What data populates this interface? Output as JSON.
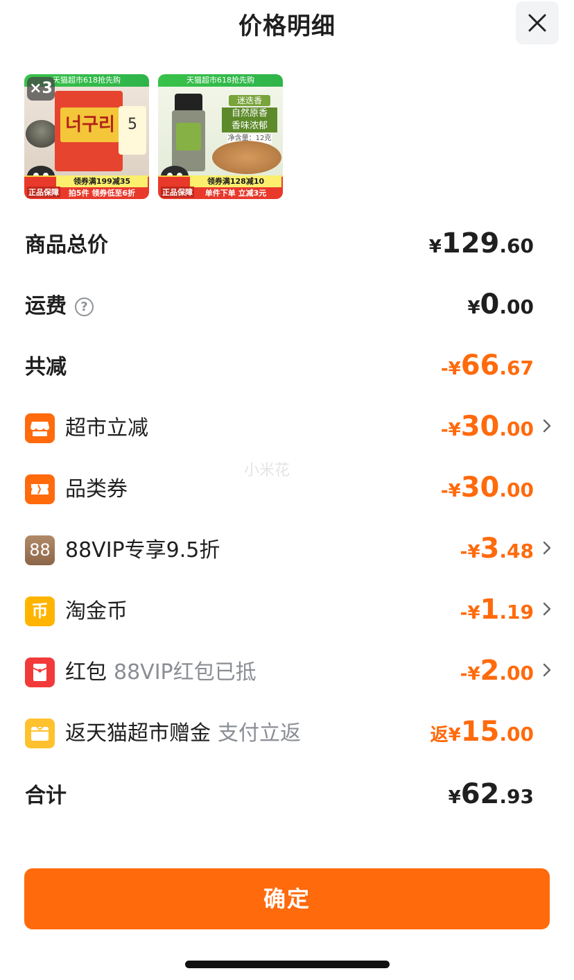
{
  "header": {
    "title": "价格明细"
  },
  "products": [
    {
      "qty_badge": "×3",
      "banner": "天猫超市618抢先购",
      "coupon_line": "领券满199减35",
      "promo_line": "拍5件 领券低至6折",
      "guarantee": "正品保障",
      "pack_text": "너구리",
      "pack_count": "5"
    },
    {
      "banner": "天猫超市618抢先购",
      "tag": "迷迭香",
      "line1": "自然原香",
      "line2": "香味浓郁",
      "net_weight": "净含量：12克",
      "coupon_line": "领券满128减10",
      "promo_line": "单件下单 立减3元",
      "guarantee": "正品保障"
    }
  ],
  "rows": {
    "subtotal": {
      "label": "商品总价",
      "symbol": "¥",
      "int": "129",
      "dec": ".60"
    },
    "shipping": {
      "label": "运费",
      "help": "?",
      "symbol": "¥",
      "int": "0",
      "dec": ".00"
    },
    "total_discount": {
      "label": "共减",
      "symbol": "-¥",
      "int": "66",
      "dec": ".67"
    },
    "supermarket_discount": {
      "label": "超市立减",
      "symbol": "-¥",
      "int": "30",
      "dec": ".00",
      "icon": "store-icon"
    },
    "category_coupon": {
      "label": "品类券",
      "symbol": "-¥",
      "int": "30",
      "dec": ".00",
      "icon": "ticket-icon"
    },
    "vip_discount": {
      "label": "88VIP专享9.5折",
      "symbol": "-¥",
      "int": "3",
      "dec": ".48",
      "icon": "88vip-icon",
      "icon_text": "88"
    },
    "gold_coin": {
      "label": "淘金币",
      "symbol": "-¥",
      "int": "1",
      "dec": ".19",
      "icon": "coin-icon",
      "icon_text": "币"
    },
    "red_packet": {
      "label": "红包",
      "sub": "88VIP红包已抵",
      "symbol": "-¥",
      "int": "2",
      "dec": ".00",
      "icon": "red-packet-icon"
    },
    "cashback": {
      "label": "返天猫超市赠金",
      "sub": "支付立返",
      "symbol": "返¥",
      "int": "15",
      "dec": ".00",
      "icon": "wallet-icon"
    },
    "grand_total": {
      "label": "合计",
      "symbol": "¥",
      "int": "62",
      "dec": ".93"
    }
  },
  "watermark": "小米花",
  "footer": {
    "confirm_label": "确定"
  },
  "colors": {
    "accent_orange": "#ff6a0c",
    "text_dark": "#1f1f1f",
    "text_gray": "#8a8d94",
    "vip_brown": "#a07a5a",
    "coin_yellow": "#ffb400",
    "red_packet": "#f23a3a",
    "wallet_yellow": "#ffc12e"
  }
}
